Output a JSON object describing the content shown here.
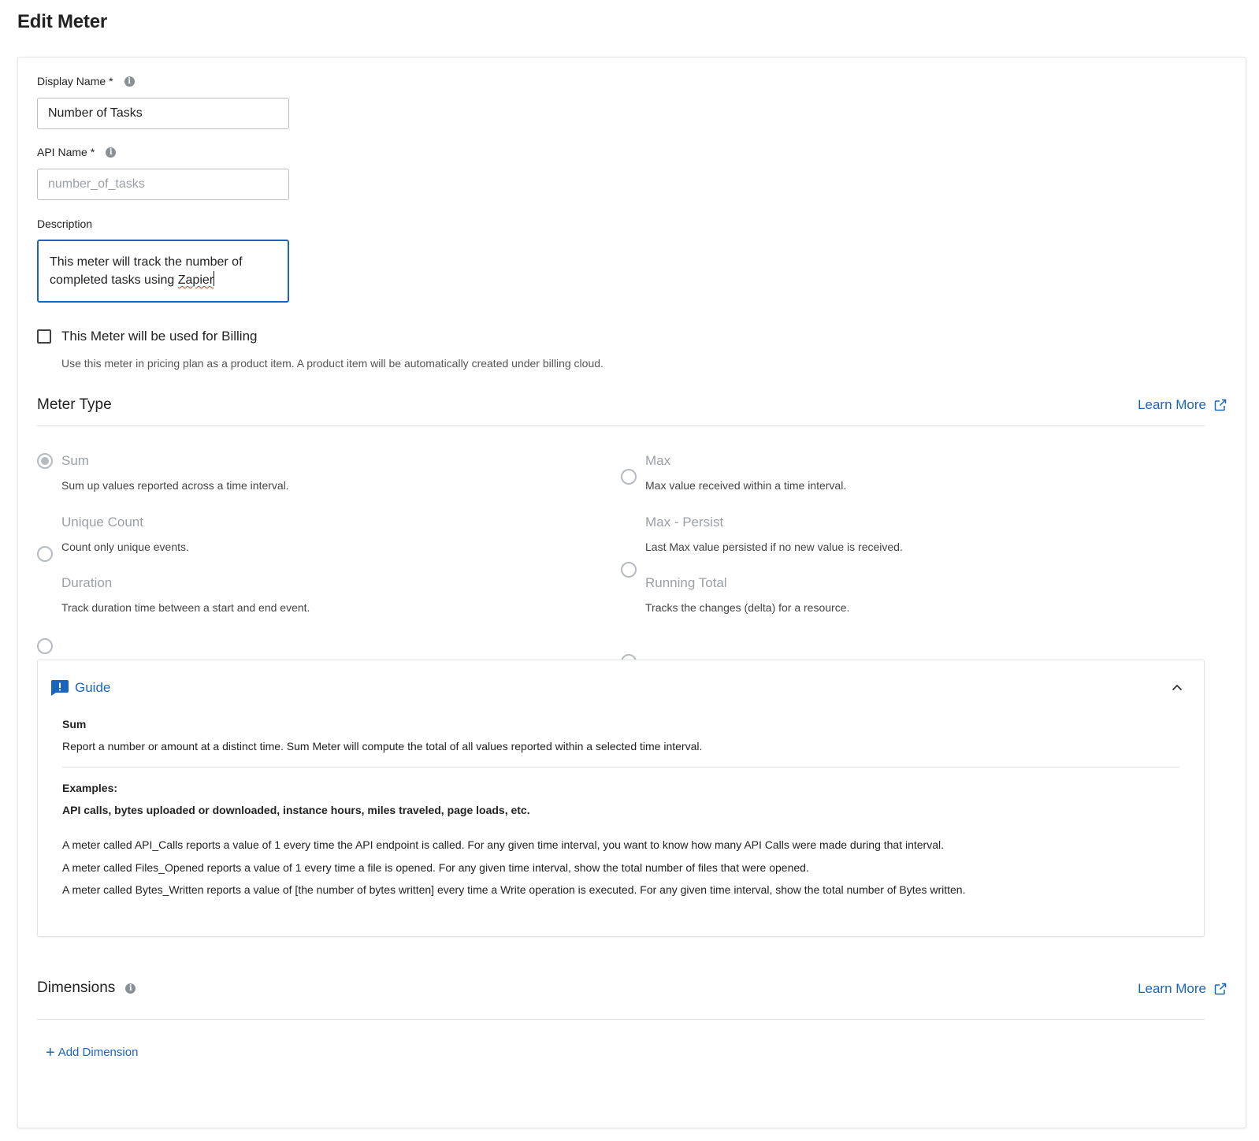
{
  "page": {
    "title": "Edit Meter"
  },
  "form": {
    "display_name": {
      "label": "Display Name",
      "required_mark": "*",
      "value": "Number of Tasks"
    },
    "api_name": {
      "label": "API Name",
      "required_mark": "*",
      "placeholder": "number_of_tasks"
    },
    "description": {
      "label": "Description",
      "value_part1": "This meter will track the number of",
      "value_part2": "completed tasks using ",
      "value_misspelled": "Zapier"
    },
    "billing": {
      "label": "This Meter will be used for Billing",
      "checked": false,
      "hint": "Use this meter in pricing plan as a product item. A product item will be automatically created under billing cloud."
    }
  },
  "meter_type": {
    "title": "Meter Type",
    "learn_more": "Learn More",
    "selected": "Sum",
    "options": [
      {
        "label": "Sum",
        "desc": "Sum up values reported across a time interval."
      },
      {
        "label": "Max",
        "desc": "Max value received within a time interval."
      },
      {
        "label": "Unique Count",
        "desc": "Count only unique events."
      },
      {
        "label": "Max - Persist",
        "desc": "Last Max value persisted if no new value is received."
      },
      {
        "label": "Duration",
        "desc": "Track duration time between a start and end event."
      },
      {
        "label": "Running Total",
        "desc": "Tracks the changes (delta) for a resource."
      }
    ]
  },
  "guide": {
    "title": "Guide",
    "heading": "Sum",
    "summary": "Report a number or amount at a distinct time. Sum Meter will compute the total of all values reported within a selected time interval.",
    "examples_label": "Examples:",
    "examples_list": "API calls, bytes uploaded or downloaded, instance hours, miles traveled, page loads, etc.",
    "details": [
      "A meter called API_Calls reports a value of 1 every time the API endpoint is called. For any given time interval, you want to know how many API Calls were made during that interval.",
      "A meter called Files_Opened reports a value of 1 every time a file is opened. For any given time interval, show the total number of files that were opened.",
      "A meter called Bytes_Written reports a value of [the number of bytes written] every time a Write operation is executed. For any given time interval, show the total number of Bytes written."
    ]
  },
  "dimensions": {
    "title": "Dimensions",
    "learn_more": "Learn More",
    "add_label": "Add Dimension"
  },
  "colors": {
    "accent": "#1a65c0",
    "border": "#e1e4e8",
    "muted": "#9ba0a6"
  },
  "icons": {
    "info": "info-circle-icon",
    "external": "external-link-icon",
    "guide": "feedback-icon",
    "collapse": "chevron-up-icon",
    "add": "plus-icon"
  }
}
